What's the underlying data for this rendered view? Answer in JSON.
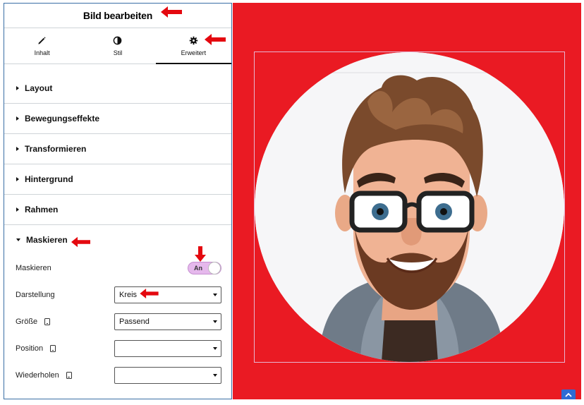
{
  "panel": {
    "title": "Bild bearbeiten",
    "tabs": [
      {
        "label": "Inhalt",
        "icon": "pencil-icon"
      },
      {
        "label": "Stil",
        "icon": "contrast-icon"
      },
      {
        "label": "Erweitert",
        "icon": "gear-icon",
        "active": true
      }
    ],
    "sections": [
      {
        "title": "Layout"
      },
      {
        "title": "Bewegungseffekte"
      },
      {
        "title": "Transformieren"
      },
      {
        "title": "Hintergrund"
      },
      {
        "title": "Rahmen"
      },
      {
        "title": "Maskieren",
        "open": true
      }
    ],
    "mask": {
      "toggle_label": "Maskieren",
      "toggle_value": "An",
      "shape_label": "Darstellung",
      "shape_value": "Kreis",
      "size_label": "Größe",
      "size_value": "Passend",
      "position_label": "Position",
      "position_value": "",
      "repeat_label": "Wiederholen",
      "repeat_value": ""
    }
  },
  "colors": {
    "canvas_bg": "#ea1a23",
    "arrow": "#e4080f",
    "toggle_on": "#e5b8ec",
    "accent_blue": "#2e6bd4"
  }
}
